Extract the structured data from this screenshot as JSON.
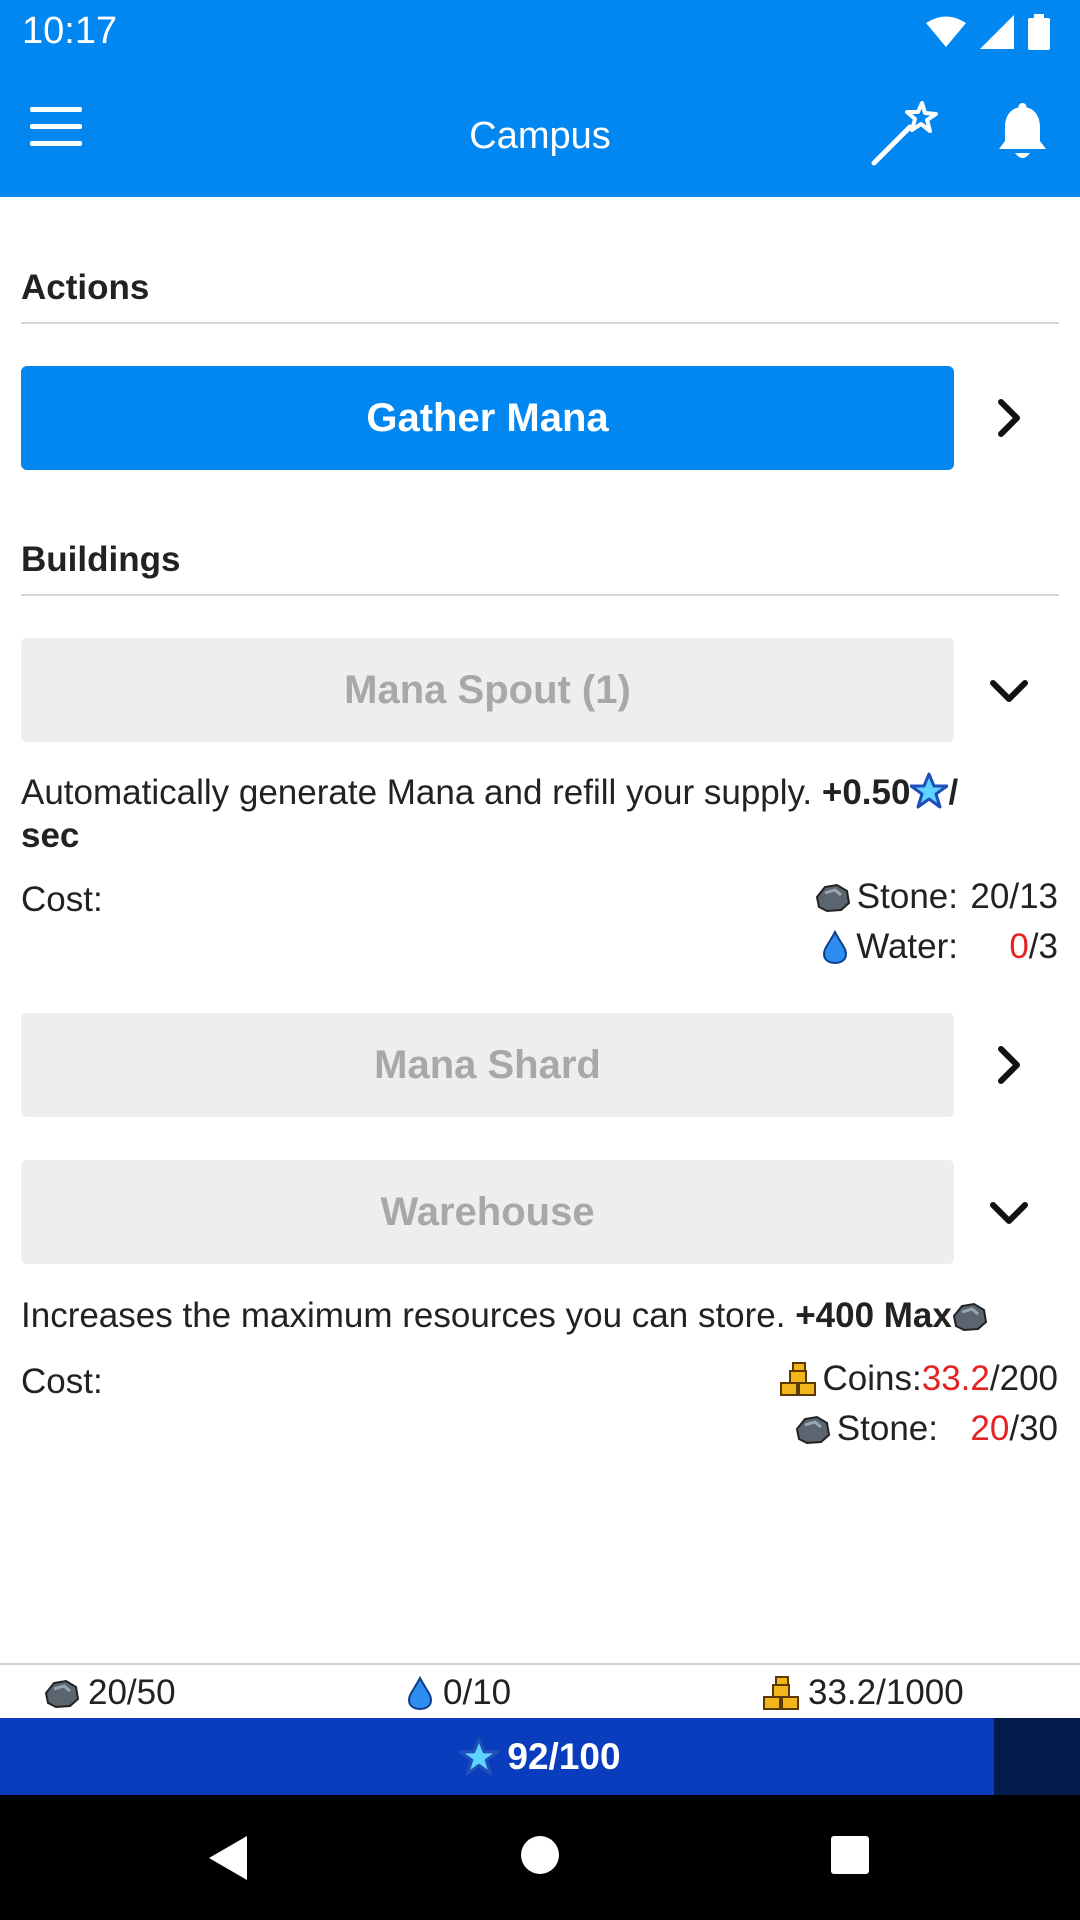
{
  "status": {
    "time": "10:17"
  },
  "appbar": {
    "title": "Campus"
  },
  "actions": {
    "heading": "Actions",
    "gather_label": "Gather Mana"
  },
  "buildings": {
    "heading": "Buildings",
    "mana_spout": {
      "label": "Mana Spout (1)",
      "desc": "Automatically generate Mana and refill your supply.",
      "bonus": "+0.50",
      "bonus_unit": "/",
      "bonus_suffix": "sec",
      "cost_label": "Cost:",
      "costs": [
        {
          "name": "Stone:",
          "have": "20",
          "need": "/13",
          "icon": "stone-icon"
        },
        {
          "name": "Water:",
          "have": "0",
          "need": "/3",
          "icon": "water-drop-icon"
        }
      ]
    },
    "mana_shard": {
      "label": "Mana Shard"
    },
    "warehouse": {
      "label": "Warehouse",
      "desc": "Increases the maximum resources you can store.",
      "bonus": "+400 Max",
      "cost_label": "Cost:",
      "costs": [
        {
          "name": "Coins:",
          "have": "33.2",
          "need": "/200",
          "icon": "coins-icon"
        },
        {
          "name": "Stone:",
          "have": "20",
          "need": "/30",
          "icon": "stone-icon"
        }
      ]
    }
  },
  "resources": {
    "stone": "20/50",
    "water": "0/10",
    "coins": "33.2/1000"
  },
  "mana": {
    "label": "92/100",
    "current": 92,
    "max": 100
  },
  "colors": {
    "primary": "#0286f0",
    "mana_fill": "#0a3dbd",
    "mana_empty": "#031a4a",
    "warn": "#e52222"
  }
}
